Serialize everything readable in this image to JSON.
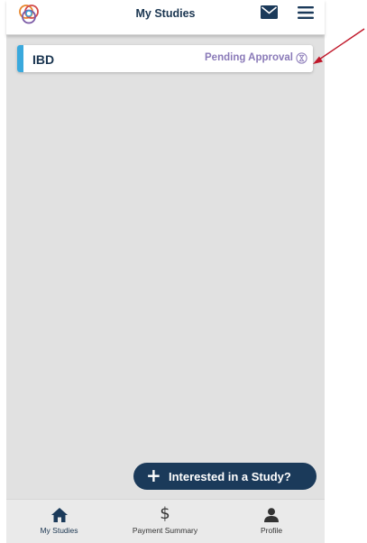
{
  "header": {
    "title": "My Studies"
  },
  "studies": [
    {
      "name": "IBD",
      "status": "Pending Approval"
    }
  ],
  "fab": {
    "label": "Interested in a Study?",
    "icon": "plus-icon"
  },
  "bottom_nav": [
    {
      "label": "My Studies",
      "icon": "home-icon",
      "active": true
    },
    {
      "label": "Payment Summary",
      "icon": "dollar-icon",
      "active": false
    },
    {
      "label": "Profile",
      "icon": "person-icon",
      "active": false
    }
  ],
  "colors": {
    "navy": "#1b3a5a",
    "accent_blue": "#3aa9dd",
    "status_purple": "#8a7ab8",
    "annotation_red": "#c0182a",
    "content_bg": "#e1e1e1",
    "nav_bg": "#eaeaea"
  }
}
